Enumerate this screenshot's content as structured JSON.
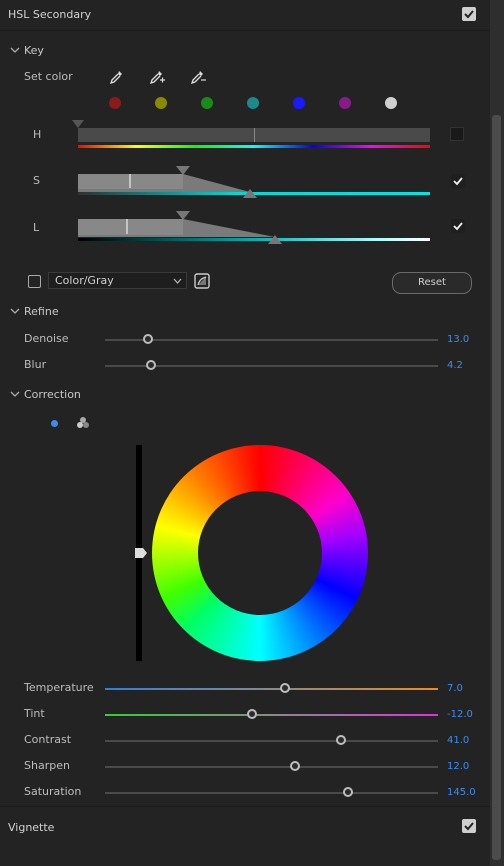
{
  "header": {
    "title": "HSL Secondary",
    "enabled": true
  },
  "key": {
    "title": "Key",
    "set_color_label": "Set color",
    "eyedroppers": [
      "eyedropper-icon",
      "eyedropper-add-icon",
      "eyedropper-subtract-icon"
    ],
    "swatches": [
      "#8b1a1a",
      "#8a8a00",
      "#1a8a1a",
      "#1a8a8a",
      "#1a1aff",
      "#8a1a8a",
      "#d0d0d0"
    ],
    "h": {
      "label": "H",
      "checked": false
    },
    "s": {
      "label": "S",
      "checked": true
    },
    "l": {
      "label": "L",
      "checked": true
    },
    "mode_checkbox": false,
    "mode_select": "Color/Gray",
    "reset_label": "Reset"
  },
  "refine": {
    "title": "Refine",
    "denoise": {
      "label": "Denoise",
      "value": "13.0",
      "pos": 0.13
    },
    "blur": {
      "label": "Blur",
      "value": "4.2",
      "pos": 0.14
    }
  },
  "correction": {
    "title": "Correction",
    "sliders": [
      {
        "key": "temperature",
        "label": "Temperature",
        "value": "7.0",
        "pos": 0.54
      },
      {
        "key": "tint",
        "label": "Tint",
        "value": "-12.0",
        "pos": 0.44
      },
      {
        "key": "contrast",
        "label": "Contrast",
        "value": "41.0",
        "pos": 0.71
      },
      {
        "key": "sharpen",
        "label": "Sharpen",
        "value": "12.0",
        "pos": 0.57
      },
      {
        "key": "saturation",
        "label": "Saturation",
        "value": "145.0",
        "pos": 0.73
      }
    ]
  },
  "vignette": {
    "title": "Vignette",
    "enabled": true
  }
}
